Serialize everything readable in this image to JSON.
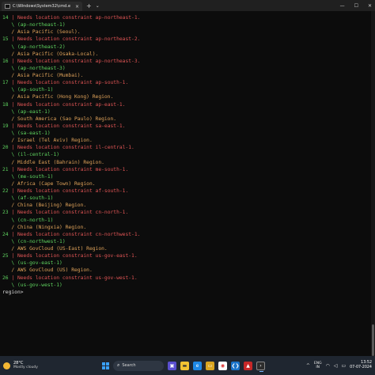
{
  "window": {
    "tab_title": "C:\\Windows\\System32\\cmd.e",
    "tab_close": "×",
    "new_tab": "+",
    "dropdown": "⌄",
    "minimize": "—",
    "maximize": "☐",
    "close": "✕"
  },
  "terminal": {
    "lines": [
      {
        "text": "14 | Needs location constraint ap-northeast-1.",
        "color": "green-red",
        "num": "14",
        "rest": " | Needs location constraint ap-northeast-1."
      },
      {
        "text": "   \\ (ap-northeast-1)",
        "color": "green"
      },
      {
        "text": "   / Asia Pacific (Seoul).",
        "color": "orange"
      },
      {
        "text": "15 | Needs location constraint ap-northeast-2.",
        "color": "green-red",
        "num": "15",
        "rest": " | Needs location constraint ap-northeast-2."
      },
      {
        "text": "   \\ (ap-northeast-2)",
        "color": "green"
      },
      {
        "text": "   / Asia Pacific (Osaka-Local).",
        "color": "orange"
      },
      {
        "text": "16 | Needs location constraint ap-northeast-3.",
        "color": "green-red",
        "num": "16",
        "rest": " | Needs location constraint ap-northeast-3."
      },
      {
        "text": "   \\ (ap-northeast-3)",
        "color": "green"
      },
      {
        "text": "   / Asia Pacific (Mumbai).",
        "color": "orange"
      },
      {
        "text": "17 | Needs location constraint ap-south-1.",
        "color": "green-red",
        "num": "17",
        "rest": " | Needs location constraint ap-south-1."
      },
      {
        "text": "   \\ (ap-south-1)",
        "color": "green"
      },
      {
        "text": "   / Asia Pacific (Hong Kong) Region.",
        "color": "orange"
      },
      {
        "text": "18 | Needs location constraint ap-east-1.",
        "color": "green-red",
        "num": "18",
        "rest": " | Needs location constraint ap-east-1."
      },
      {
        "text": "   \\ (ap-east-1)",
        "color": "green"
      },
      {
        "text": "   / South America (Sao Paulo) Region.",
        "color": "orange"
      },
      {
        "text": "19 | Needs location constraint sa-east-1.",
        "color": "green-red",
        "num": "19",
        "rest": " | Needs location constraint sa-east-1."
      },
      {
        "text": "   \\ (sa-east-1)",
        "color": "green"
      },
      {
        "text": "   / Israel (Tel Aviv) Region.",
        "color": "orange"
      },
      {
        "text": "20 | Needs location constraint il-central-1.",
        "color": "green-red",
        "num": "20",
        "rest": " | Needs location constraint il-central-1."
      },
      {
        "text": "   \\ (il-central-1)",
        "color": "green"
      },
      {
        "text": "   / Middle East (Bahrain) Region.",
        "color": "orange"
      },
      {
        "text": "21 | Needs location constraint me-south-1.",
        "color": "green-red",
        "num": "21",
        "rest": " | Needs location constraint me-south-1."
      },
      {
        "text": "   \\ (me-south-1)",
        "color": "green"
      },
      {
        "text": "   / Africa (Cape Town) Region.",
        "color": "orange"
      },
      {
        "text": "22 | Needs location constraint af-south-1.",
        "color": "green-red",
        "num": "22",
        "rest": " | Needs location constraint af-south-1."
      },
      {
        "text": "   \\ (af-south-1)",
        "color": "green"
      },
      {
        "text": "   / China (Beijing) Region.",
        "color": "orange"
      },
      {
        "text": "23 | Needs location constraint cn-north-1.",
        "color": "green-red",
        "num": "23",
        "rest": " | Needs location constraint cn-north-1."
      },
      {
        "text": "   \\ (cn-north-1)",
        "color": "green"
      },
      {
        "text": "   / China (Ningxia) Region.",
        "color": "orange"
      },
      {
        "text": "24 | Needs location constraint cn-northwest-1.",
        "color": "green-red",
        "num": "24",
        "rest": " | Needs location constraint cn-northwest-1."
      },
      {
        "text": "   \\ (cn-northwest-1)",
        "color": "green"
      },
      {
        "text": "   / AWS GovCloud (US-East) Region.",
        "color": "orange"
      },
      {
        "text": "25 | Needs location constraint us-gov-east-1.",
        "color": "green-red",
        "num": "25",
        "rest": " | Needs location constraint us-gov-east-1."
      },
      {
        "text": "   \\ (us-gov-east-1)",
        "color": "green"
      },
      {
        "text": "   / AWS GovCloud (US) Region.",
        "color": "orange"
      },
      {
        "text": "26 | Needs location constraint us-gov-west-1.",
        "color": "green-red",
        "num": "26",
        "rest": " | Needs location constraint us-gov-west-1."
      },
      {
        "text": "   \\ (us-gov-west-1)",
        "color": "green"
      },
      {
        "text": "region>",
        "color": "white"
      }
    ],
    "colors": {
      "green": "#5fd35f",
      "red": "#e05555",
      "orange": "#e0a35a",
      "white": "#d8d8d8",
      "background": "#0c0c0c"
    }
  },
  "taskbar": {
    "weather_temp": "28°C",
    "weather_desc": "Mostly cloudy",
    "search_placeholder": "Search",
    "icons": [
      "windows-icon",
      "search-icon",
      "file-explorer-icon",
      "edge-icon",
      "folder-icon",
      "chrome-icon",
      "vscode-icon",
      "app-icon",
      "terminal-icon"
    ],
    "tray_chevron": "^",
    "lang_top": "ENG",
    "lang_bottom": "IN",
    "wifi": "wifi-icon",
    "volume": "volume-icon",
    "battery": "battery-icon",
    "time": "13:52",
    "date": "07-07-2024"
  }
}
